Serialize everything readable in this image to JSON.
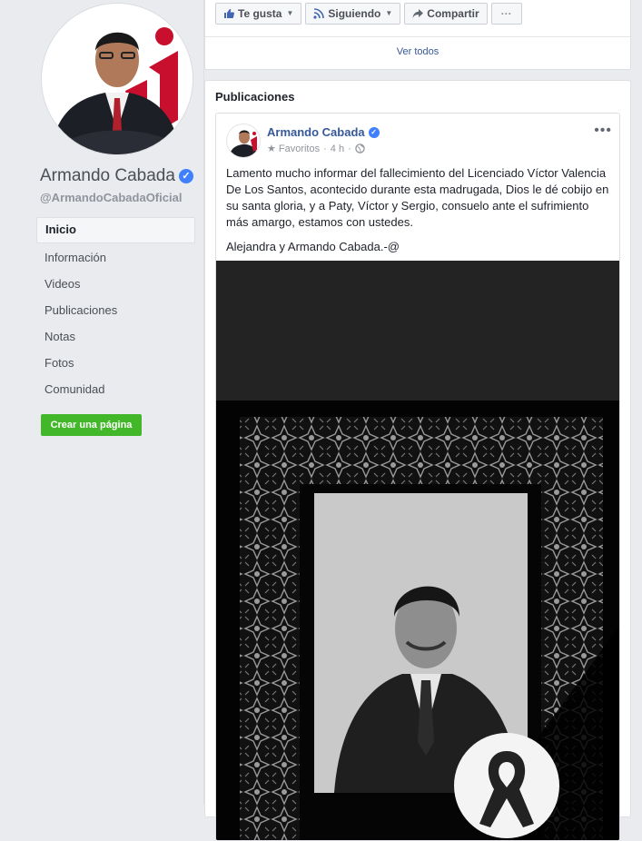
{
  "profile": {
    "name": "Armando Cabada",
    "handle": "@ArmandoCabadaOficial"
  },
  "nav": {
    "items": [
      {
        "label": "Inicio",
        "active": true
      },
      {
        "label": "Información"
      },
      {
        "label": "Videos"
      },
      {
        "label": "Publicaciones"
      },
      {
        "label": "Notas"
      },
      {
        "label": "Fotos"
      },
      {
        "label": "Comunidad"
      }
    ],
    "create_page_label": "Crear una página"
  },
  "actions": {
    "like_label": "Te gusta",
    "following_label": "Siguiendo",
    "share_label": "Compartir",
    "more_label": "···"
  },
  "see_all_label": "Ver todos",
  "posts_section": {
    "title": "Publicaciones"
  },
  "post": {
    "author": "Armando Cabada",
    "audience": "Favoritos",
    "time": "4 h",
    "menu": "•••",
    "text_paragraphs": [
      "Lamento mucho informar del fallecimiento del Licenciado Víctor Valencia De Los Santos, acontecido durante esta madrugada, Dios le dé cobijo en su santa gloria, y a Paty, Víctor y Sergio, consuelo ante el sufrimiento más amargo, estamos con ustedes.",
      "Alejandra y Armando Cabada.-@"
    ]
  },
  "colors": {
    "link": "#365899",
    "accent_green": "#42b72a",
    "verified_blue": "#4080ff",
    "page_bg": "#e9ebee"
  }
}
